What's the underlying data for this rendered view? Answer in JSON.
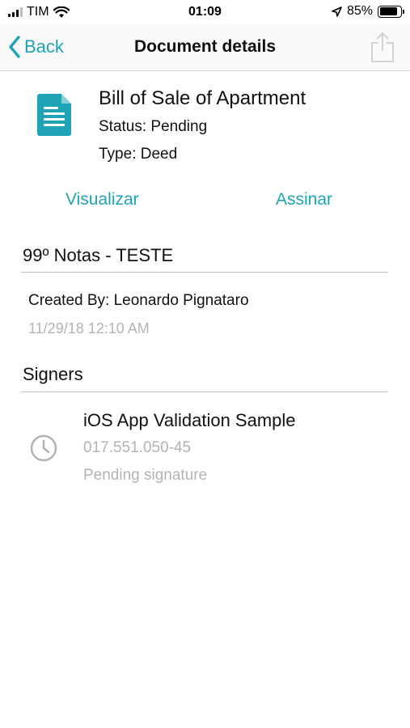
{
  "status_bar": {
    "carrier": "TIM",
    "time": "01:09",
    "battery_percent": "85%",
    "battery_level": 0.85,
    "icons": [
      "signal-icon",
      "wifi-icon",
      "location-arrow-icon",
      "battery-icon"
    ]
  },
  "nav": {
    "back_label": "Back",
    "title": "Document details",
    "share_icon": "share-icon"
  },
  "document": {
    "icon": "document-icon",
    "title": "Bill of Sale of Apartment",
    "status": "Status: Pending",
    "type": "Type: Deed"
  },
  "actions": {
    "view_label": "Visualizar",
    "sign_label": "Assinar"
  },
  "office": {
    "title": "99º Notas - TESTE",
    "created_by": "Created By: Leonardo Pignataro",
    "created_date": "11/29/18 12:10 AM"
  },
  "signers": {
    "title": "Signers",
    "items": [
      {
        "icon": "clock-icon",
        "name": "iOS App Validation Sample",
        "id": "017.551.050-45",
        "status": "Pending signature"
      }
    ]
  },
  "colors": {
    "accent": "#1fa4b5",
    "muted_text": "#b3b3b3",
    "divider": "#bdbdbd"
  }
}
